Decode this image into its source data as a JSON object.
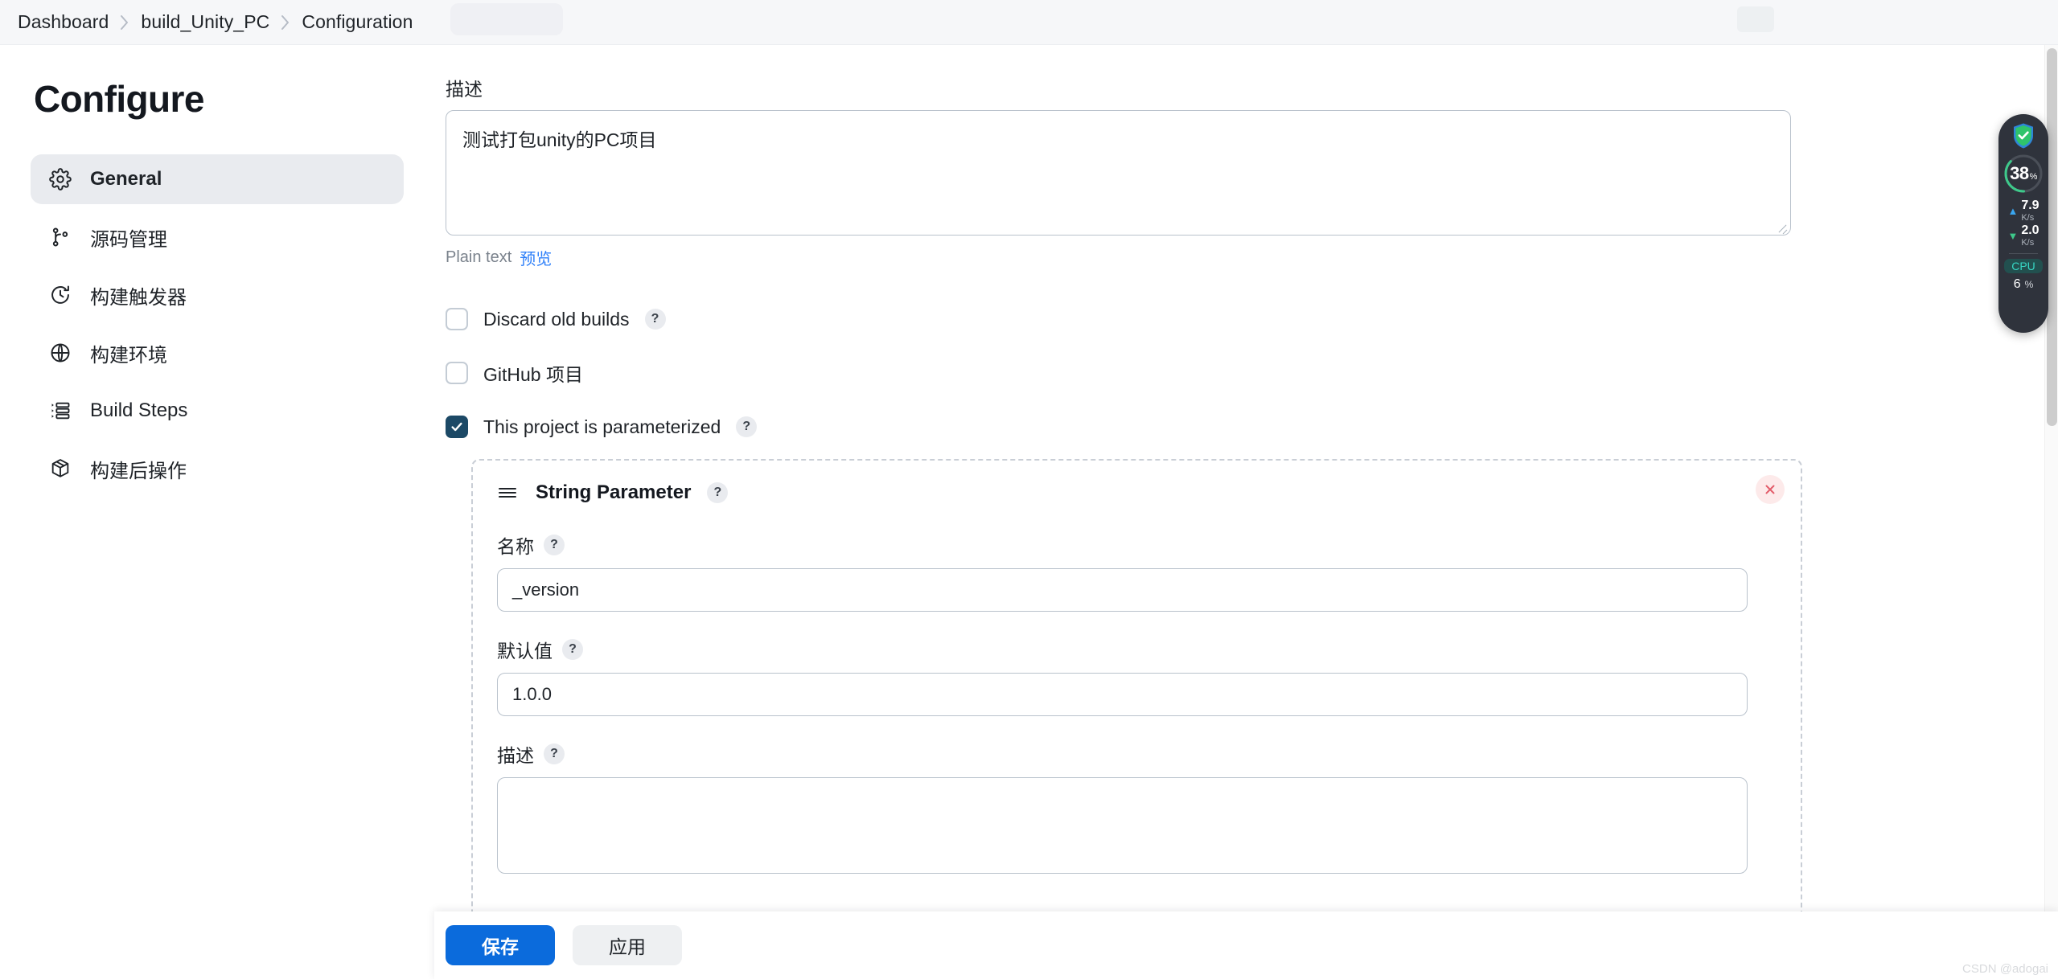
{
  "breadcrumb": {
    "items": [
      "Dashboard",
      "build_Unity_PC",
      "Configuration"
    ]
  },
  "sidebar": {
    "title": "Configure",
    "items": [
      {
        "label": "General",
        "icon": "gear-icon",
        "active": true
      },
      {
        "label": "源码管理",
        "icon": "branch-icon",
        "active": false
      },
      {
        "label": "构建触发器",
        "icon": "clock-icon",
        "active": false
      },
      {
        "label": "构建环境",
        "icon": "globe-icon",
        "active": false
      },
      {
        "label": "Build Steps",
        "icon": "list-steps-icon",
        "active": false
      },
      {
        "label": "构建后操作",
        "icon": "package-box-icon",
        "active": false
      }
    ]
  },
  "form": {
    "description": {
      "label": "描述",
      "value": "测试打包unity的PC项目",
      "format_text": "Plain text",
      "preview_link": "预览"
    },
    "checkboxes": [
      {
        "label": "Discard old builds",
        "checked": false,
        "help": "?"
      },
      {
        "label": "GitHub 项目",
        "checked": false,
        "help": null
      },
      {
        "label": "This project is parameterized",
        "checked": true,
        "help": "?"
      }
    ],
    "parameter": {
      "title": "String Parameter",
      "help": "?",
      "close_label": "×",
      "name_label": "名称",
      "name_value": "_version",
      "default_label": "默认值",
      "default_value": "1.0.0",
      "desc_label": "描述",
      "desc_value": ""
    }
  },
  "actions": {
    "save_label": "保存",
    "apply_label": "应用"
  },
  "monitor": {
    "ring_value": "38",
    "ring_unit": "%",
    "upload_value": "7.9",
    "upload_unit": "K/s",
    "download_value": "2.0",
    "download_unit": "K/s",
    "cpu_label": "CPU",
    "cpu_value": "6",
    "cpu_unit": "%"
  },
  "watermark": "CSDN @adogai",
  "colors": {
    "primary_button": "#0b6bdc",
    "link": "#2d7ff9",
    "checkbox_checked": "#1c4966",
    "ring_green": "#3ec98b",
    "cpu_teal": "#37d6c4"
  }
}
